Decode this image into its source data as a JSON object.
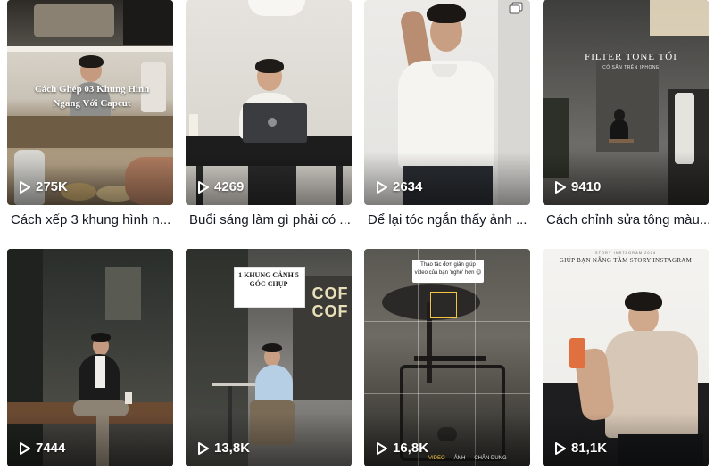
{
  "videos": [
    {
      "views": "275K",
      "caption": "Cách xếp 3 khung hình n...",
      "overlay": "Cách Ghép 03 Khung Hình Ngang Với Capcut"
    },
    {
      "views": "4269",
      "caption": "Buổi sáng làm gì phải có ..."
    },
    {
      "views": "2634",
      "caption": "Để lại tóc ngắn thấy ảnh ..."
    },
    {
      "views": "9410",
      "caption": "Cách chỉnh sửa tông màu...",
      "overlay": "FILTER TONE TỐI",
      "overlay_sub": "CÓ SẴN TRÊN IPHONE"
    },
    {
      "views": "7444"
    },
    {
      "views": "13,8K",
      "overlay": "1 KHUNG CẢNH 5 GÓC CHỤP",
      "sign": "COF COF"
    },
    {
      "views": "16,8K",
      "overlay": "Thao tác đơn giản giúp video của bạn 'nghệ' hơn 😉",
      "camera_modes": [
        "VIDEO",
        "ẢNH",
        "CHÂN DUNG"
      ]
    },
    {
      "views": "81,1K",
      "overlay_small": "STORY INSTAGRAM 2024",
      "overlay": "GIÚP BẠN NÂNG TẦM STORY INSTAGRAM"
    }
  ],
  "icons": {
    "play": "play-icon",
    "multi": "multiple-images-icon"
  }
}
